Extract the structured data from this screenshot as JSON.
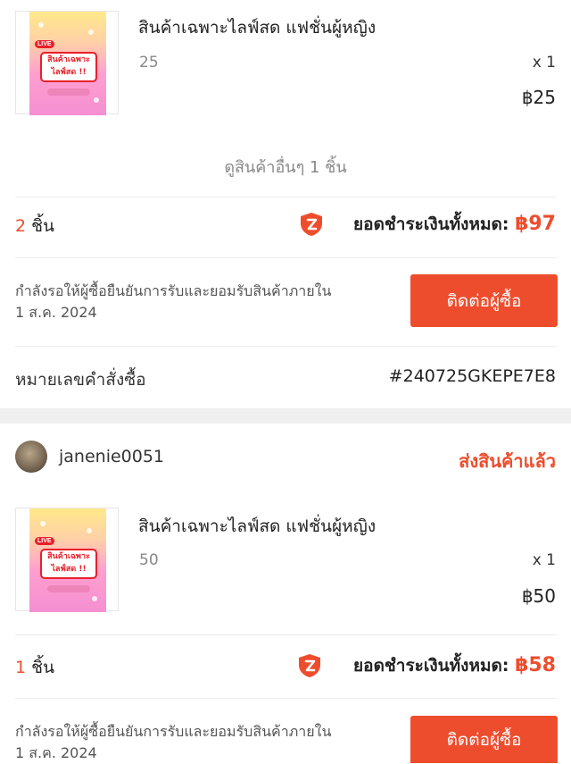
{
  "orders": [
    {
      "items": [
        {
          "name": "สินค้าเฉพาะไลฟ์สด แฟชั่นผู้หญิง",
          "variant": "25",
          "quantity": "x 1",
          "price": "฿25",
          "thumb_live": "LIVE",
          "thumb_text_1": "สินค้าเฉพาะ",
          "thumb_text_2": "ไลฟ์สด !!"
        }
      ],
      "view_more": "ดูสินค้าอื่นๆ 1 ชิ้น",
      "count_number": "2",
      "count_unit": "ชิ้น",
      "total_label": "ยอดชำระเงินทั้งหมด:",
      "total_value": "฿97",
      "status_line_1": "กำลังรอให้ผู้ซื้อยืนยันการรับและยอมรับสินค้าภายใน",
      "status_line_2": "1 ส.ค. 2024",
      "contact_button": "ติดต่อผู้ซื้อ",
      "order_id_label": "หมายเลขคำสั่งซื้อ",
      "order_id": "#240725GKEPE7E8"
    },
    {
      "buyer": "janenie0051",
      "status": "ส่งสินค้าแล้ว",
      "items": [
        {
          "name": "สินค้าเฉพาะไลฟ์สด แฟชั่นผู้หญิง",
          "variant": "50",
          "quantity": "x 1",
          "price": "฿50",
          "thumb_live": "LIVE",
          "thumb_text_1": "สินค้าเฉพาะ",
          "thumb_text_2": "ไลฟ์สด !!"
        }
      ],
      "count_number": "1",
      "count_unit": "ชิ้น",
      "total_label": "ยอดชำระเงินทั้งหมด:",
      "total_value": "฿58",
      "status_line_1": "กำลังรอให้ผู้ซื้อยืนยันการรับและยอมรับสินค้าภายใน",
      "status_line_2": "1 ส.ค. 2024",
      "contact_button": "ติดต่อผู้ซื้อ"
    }
  ],
  "colors": {
    "accent": "#ee4d2d",
    "separator": "#ececec",
    "section_gap": "#efefef"
  }
}
